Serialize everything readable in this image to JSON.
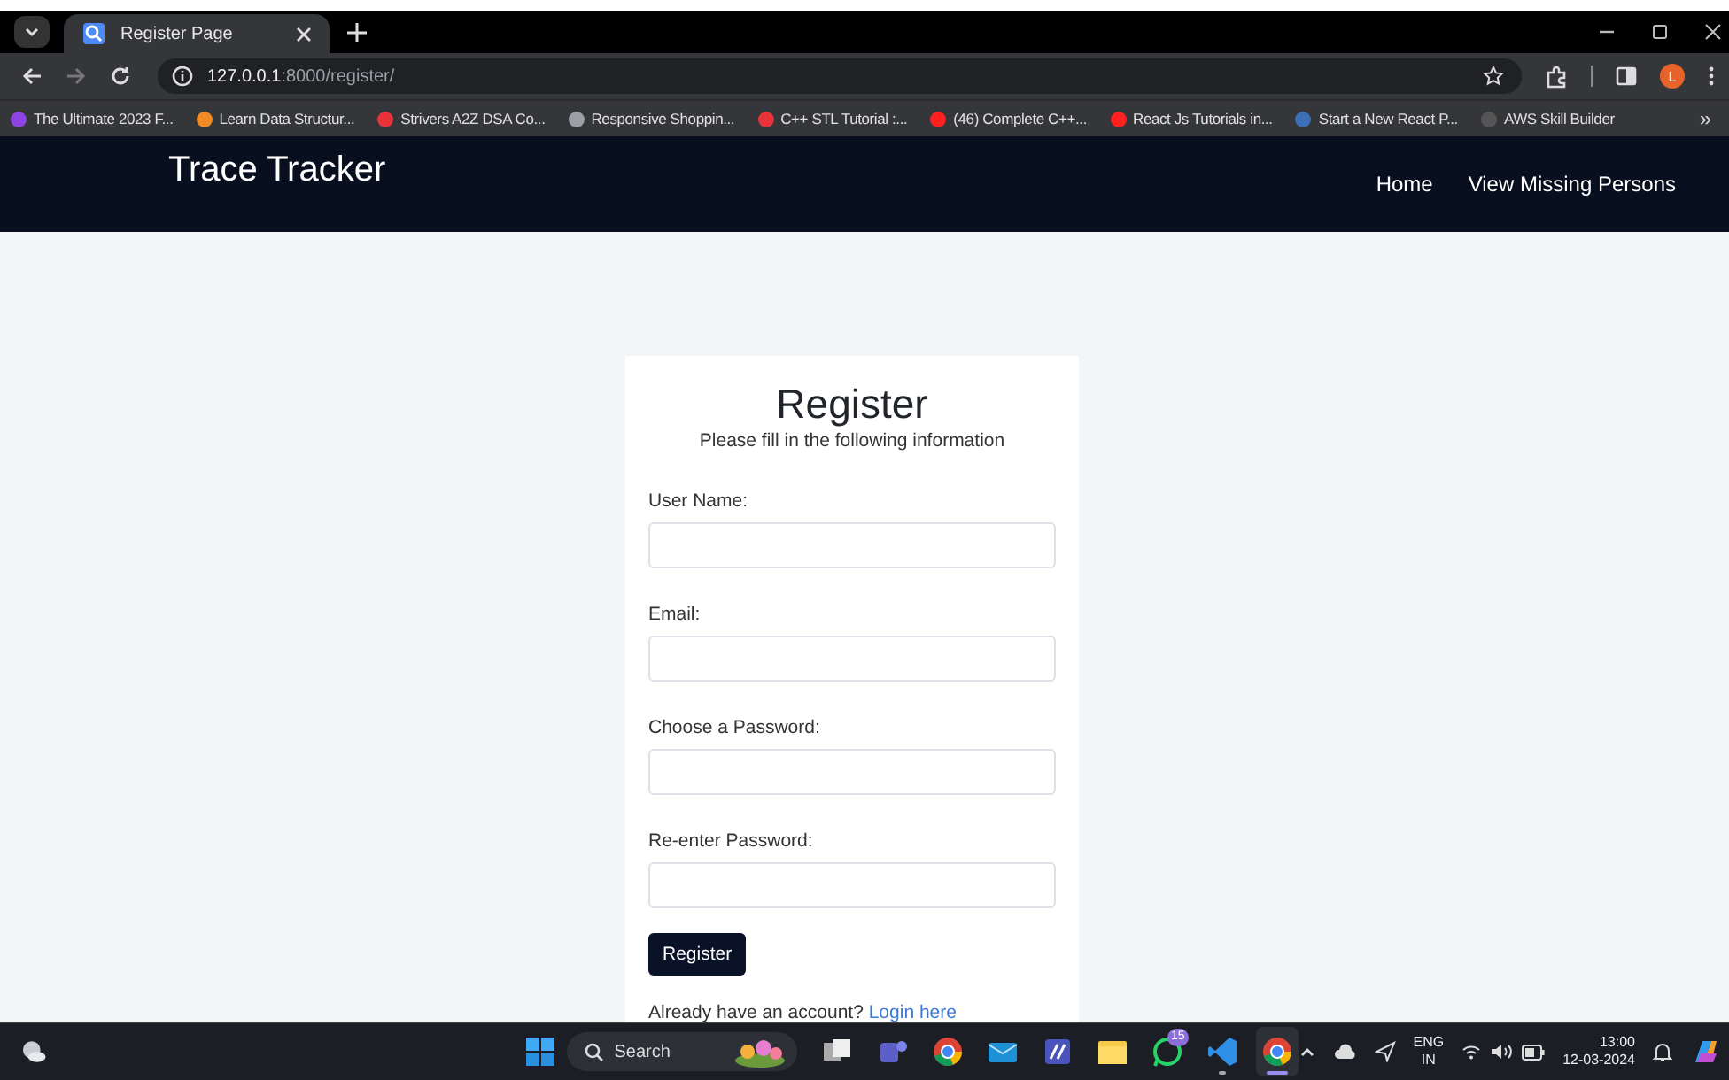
{
  "browser": {
    "tab": {
      "title": "Register Page"
    },
    "address": {
      "host": "127.0.0.1",
      "path": ":8000/register/"
    },
    "profile_initial": "L",
    "bookmarks": [
      {
        "label": "The Ultimate 2023 F...",
        "color": "#8e44e0"
      },
      {
        "label": "Learn Data Structur...",
        "color": "#f08a24"
      },
      {
        "label": "Strivers A2Z DSA Co...",
        "color": "#e8333a"
      },
      {
        "label": "Responsive Shoppin...",
        "color": "#9aa0a6"
      },
      {
        "label": "C++ STL Tutorial :...",
        "color": "#e8333a"
      },
      {
        "label": "(46) Complete C++...",
        "color": "#ff2020"
      },
      {
        "label": "React Js Tutorials in...",
        "color": "#ff2020"
      },
      {
        "label": "Start a New React P...",
        "color": "#3b6fb6"
      },
      {
        "label": "AWS Skill Builder",
        "color": "#555555"
      }
    ],
    "more": "»"
  },
  "navbar": {
    "brand": "Trace Tracker",
    "links": [
      "Home",
      "View Missing Persons"
    ]
  },
  "form": {
    "title": "Register",
    "subtitle": "Please fill in the following information",
    "fields": [
      {
        "label": "User Name:"
      },
      {
        "label": "Email:"
      },
      {
        "label": "Choose a Password:"
      },
      {
        "label": "Re-enter Password:"
      }
    ],
    "submit": "Register",
    "footer": "Already have an account?",
    "login_link": "Login here"
  },
  "taskbar": {
    "search": "Search",
    "apps": [
      {
        "kind": "taskview",
        "running": false,
        "selected": false
      },
      {
        "kind": "teams",
        "running": false,
        "selected": false
      },
      {
        "kind": "chrome",
        "running": false,
        "selected": false
      },
      {
        "kind": "mail",
        "running": false,
        "selected": false
      },
      {
        "kind": "board",
        "running": false,
        "selected": false
      },
      {
        "kind": "files",
        "running": false,
        "selected": false
      },
      {
        "kind": "whatsapp",
        "running": false,
        "selected": false,
        "badge": "15"
      },
      {
        "kind": "vscode",
        "running": true,
        "selected": false
      },
      {
        "kind": "chrome",
        "running": true,
        "selected": true
      }
    ],
    "language": "ENG",
    "region": "IN",
    "time": "13:00",
    "date": "12-03-2024"
  }
}
